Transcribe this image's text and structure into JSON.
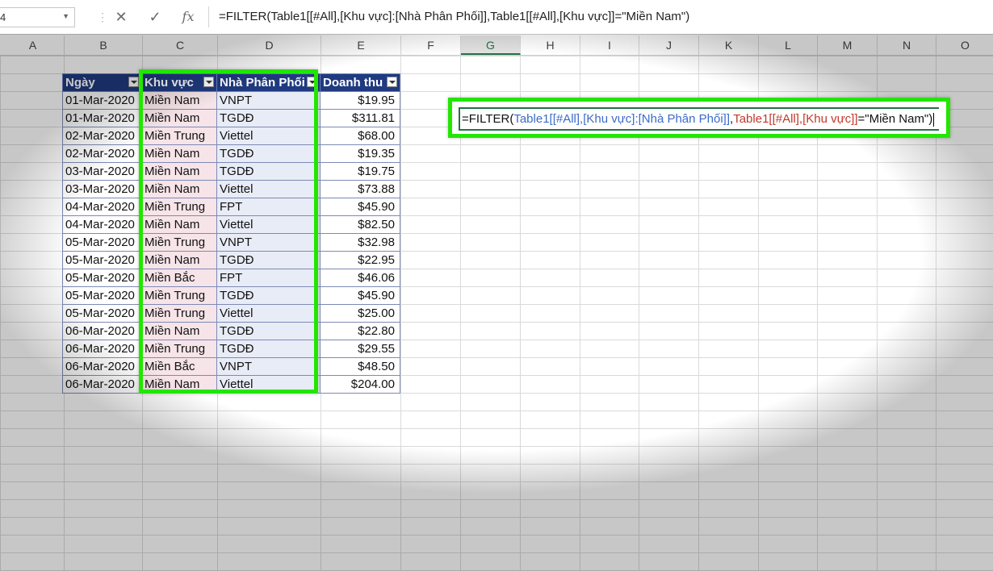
{
  "formula_bar": {
    "name_box": "4",
    "cancel_icon": "close-icon",
    "enter_icon": "check-icon",
    "fx_label": "fx",
    "formula": "=FILTER(Table1[[#All],[Khu vực]:[Nhà Phân Phối]],Table1[[#All],[Khu vực]]=\"Miền Nam\")"
  },
  "columns": [
    "A",
    "B",
    "C",
    "D",
    "E",
    "F",
    "G",
    "H",
    "I",
    "J",
    "K",
    "L",
    "M",
    "N",
    "O"
  ],
  "selected_column": "G",
  "table": {
    "headers": [
      "Ngày",
      "Khu vực",
      "Nhà Phân Phối",
      "Doanh thu"
    ],
    "rows": [
      [
        "01-Mar-2020",
        "Miền Nam",
        "VNPT",
        "$19.95"
      ],
      [
        "01-Mar-2020",
        "Miền Nam",
        "TGDĐ",
        "$311.81"
      ],
      [
        "02-Mar-2020",
        "Miền Trung",
        "Viettel",
        "$68.00"
      ],
      [
        "02-Mar-2020",
        "Miền Nam",
        "TGDĐ",
        "$19.35"
      ],
      [
        "03-Mar-2020",
        "Miền Nam",
        "TGDĐ",
        "$19.75"
      ],
      [
        "03-Mar-2020",
        "Miền Nam",
        "Viettel",
        "$73.88"
      ],
      [
        "04-Mar-2020",
        "Miền Trung",
        "FPT",
        "$45.90"
      ],
      [
        "04-Mar-2020",
        "Miền Nam",
        "Viettel",
        "$82.50"
      ],
      [
        "05-Mar-2020",
        "Miền Trung",
        "VNPT",
        "$32.98"
      ],
      [
        "05-Mar-2020",
        "Miền Nam",
        "TGDĐ",
        "$22.95"
      ],
      [
        "05-Mar-2020",
        "Miền Bắc",
        "FPT",
        "$46.06"
      ],
      [
        "05-Mar-2020",
        "Miền Trung",
        "TGDĐ",
        "$45.90"
      ],
      [
        "05-Mar-2020",
        "Miền Trung",
        "Viettel",
        "$25.00"
      ],
      [
        "06-Mar-2020",
        "Miền Nam",
        "TGDĐ",
        "$22.80"
      ],
      [
        "06-Mar-2020",
        "Miền Trung",
        "TGDĐ",
        "$29.55"
      ],
      [
        "06-Mar-2020",
        "Miền Bắc",
        "VNPT",
        "$48.50"
      ],
      [
        "06-Mar-2020",
        "Miền Nam",
        "Viettel",
        "$204.00"
      ]
    ]
  },
  "cell_formula": {
    "fn": "=FILTER(",
    "arg1": "Table1[[#All],[Khu vực]:[Nhà Phân Phối]]",
    "comma": ",",
    "arg2": "Table1[[#All],[Khu vực]]",
    "rest": "=\"Miền Nam\")"
  },
  "colors": {
    "highlight": "#22e600",
    "table_header": "#1f3a80",
    "ref_blue": "#3c6bc7",
    "ref_red": "#c0392b"
  }
}
